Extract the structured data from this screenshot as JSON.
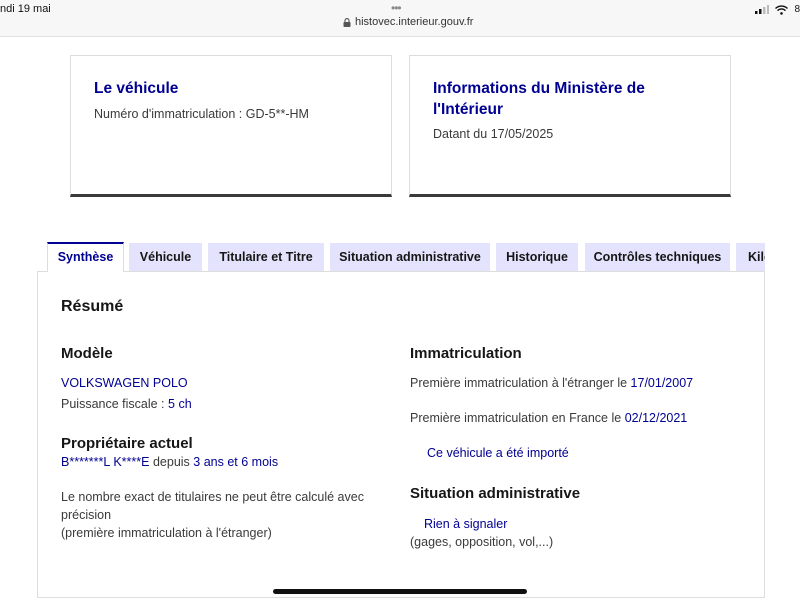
{
  "status_bar": {
    "date": "ndi 19 mai",
    "dots": "•••",
    "url": "histovec.interieur.gouv.fr",
    "battery": "8"
  },
  "cards": {
    "vehicle": {
      "title": "Le véhicule",
      "plate_label": "Numéro d'immatriculation :",
      "plate_value": "GD-5**-HM"
    },
    "ministry": {
      "title": "Informations du Ministère de l'Intérieur",
      "date_label": "Datant du",
      "date_value": "17/05/2025"
    }
  },
  "tabs": [
    "Synthèse",
    "Véhicule",
    "Titulaire et Titre",
    "Situation administrative",
    "Historique",
    "Contrôles techniques",
    "Kilométrage"
  ],
  "active_tab": "Synthèse",
  "summary": {
    "heading": "Résumé",
    "model": {
      "heading": "Modèle",
      "name": "VOLKSWAGEN POLO",
      "fiscal_label": "Puissance fiscale :",
      "fiscal_value": "5 ch"
    },
    "owner": {
      "heading": "Propriétaire actuel",
      "name": "B*******L K****E",
      "since_label": "depuis",
      "since_value": "3 ans et 6 mois",
      "note_line1": "Le nombre exact de titulaires ne peut être calculé avec",
      "note_line2": "précision",
      "note_line3": "(première immatriculation à l'étranger)"
    },
    "registration": {
      "heading": "Immatriculation",
      "foreign_label": "Première immatriculation à l'étranger le",
      "foreign_date": "17/01/2007",
      "france_label": "Première immatriculation en France le",
      "france_date": "02/12/2021",
      "imported": "Ce véhicule a été importé"
    },
    "admin": {
      "heading": "Situation administrative",
      "status": "Rien à signaler",
      "detail": "(gages, opposition, vol,...)"
    }
  }
}
